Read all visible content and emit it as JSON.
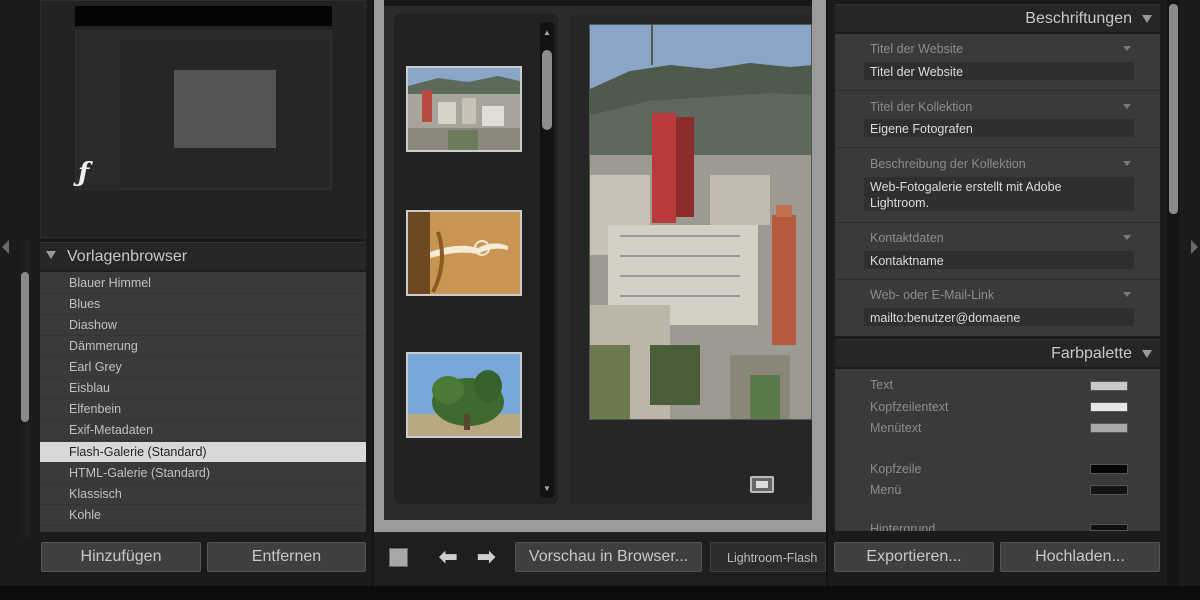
{
  "left_panel": {
    "template_browser": {
      "title": "Vorlagenbrowser",
      "items": [
        "Blauer Himmel",
        "Blues",
        "Diashow",
        "Dämmerung",
        "Earl Grey",
        "Eisblau",
        "Elfenbein",
        "Exif-Metadaten",
        "Flash-Galerie (Standard)",
        "HTML-Galerie (Standard)",
        "Klassisch",
        "Kohle"
      ],
      "selected": "Flash-Galerie (Standard)"
    },
    "buttons": {
      "add": "Hinzufügen",
      "remove": "Entfernen"
    }
  },
  "center": {
    "toolbar": {
      "preview_button": "Vorschau in Browser...",
      "engine_combo": "Lightroom-Flash"
    }
  },
  "right_panel": {
    "captions": {
      "title": "Beschriftungen",
      "fields": [
        {
          "label": "Titel der Website",
          "value": "Titel der Website"
        },
        {
          "label": "Titel der Kollektion",
          "value": "Eigene Fotografen"
        },
        {
          "label": "Beschreibung der Kollektion",
          "value": "Web-Fotogalerie erstellt mit Adobe Lightroom."
        },
        {
          "label": "Kontaktdaten",
          "value": "Kontaktname"
        },
        {
          "label": "Web- oder E-Mail-Link",
          "value": "mailto:benutzer@domaene"
        }
      ]
    },
    "palette": {
      "title": "Farbpalette",
      "items": [
        {
          "label": "Text",
          "color": "#c8c8c8"
        },
        {
          "label": "Kopfzeilentext",
          "color": "#e6e6e6"
        },
        {
          "label": "Menütext",
          "color": "#a8a8a8"
        },
        {
          "label": "Kopfzeile",
          "color": "#050505"
        },
        {
          "label": "Menü",
          "color": "#141414"
        },
        {
          "label": "Hintergrund",
          "color": "#101010"
        }
      ]
    },
    "buttons": {
      "export": "Exportieren...",
      "upload": "Hochladen..."
    }
  }
}
